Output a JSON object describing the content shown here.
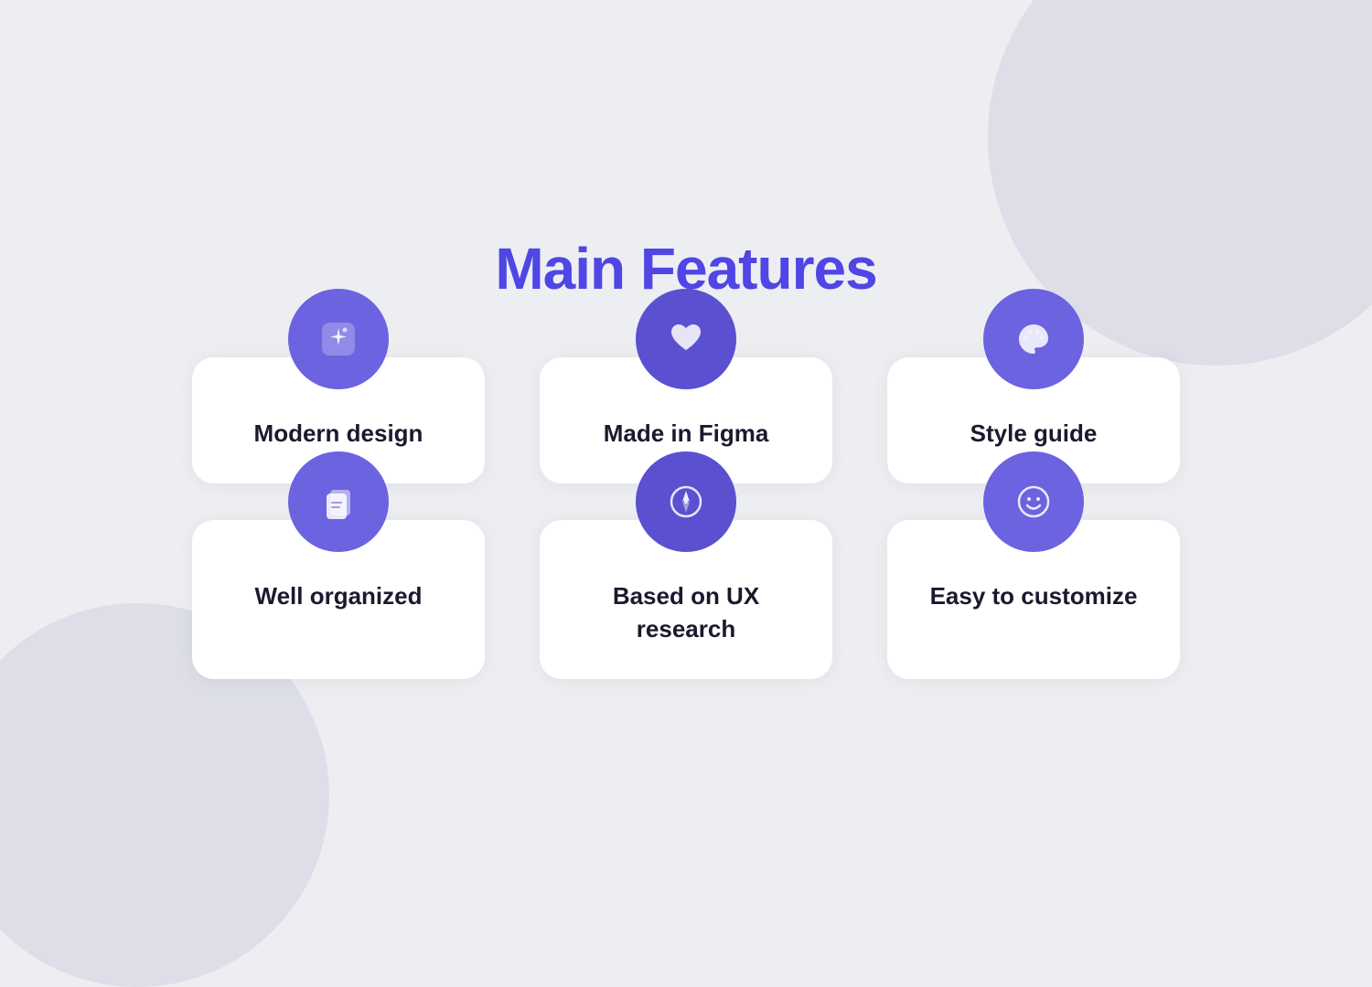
{
  "page": {
    "title": "Main Features",
    "title_color": "#4f46e5",
    "background_color": "#edeef2"
  },
  "features": [
    {
      "id": "modern-design",
      "label": "Modern design",
      "icon": "sparkle",
      "icon_color": "purple-medium"
    },
    {
      "id": "made-in-figma",
      "label": "Made in Figma",
      "icon": "heart",
      "icon_color": "purple-dark"
    },
    {
      "id": "style-guide",
      "label": "Style guide",
      "icon": "palette",
      "icon_color": "purple-medium"
    },
    {
      "id": "well-organized",
      "label": "Well organized",
      "icon": "documents",
      "icon_color": "purple-medium"
    },
    {
      "id": "ux-research",
      "label": "Based  on UX research",
      "icon": "compass",
      "icon_color": "purple-dark"
    },
    {
      "id": "easy-to-customize",
      "label": "Easy to customize",
      "icon": "smiley",
      "icon_color": "purple-medium"
    }
  ]
}
